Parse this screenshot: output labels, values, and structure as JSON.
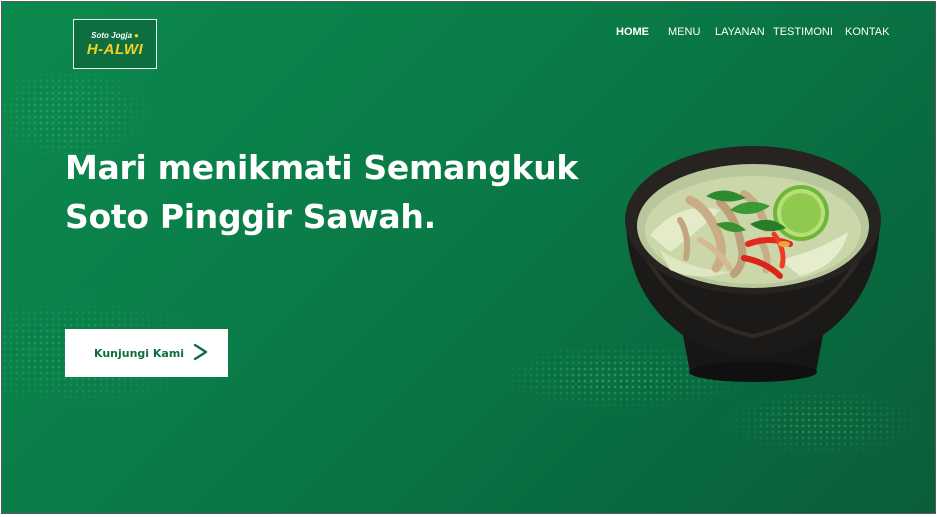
{
  "logo": {
    "top_text": "Soto Jogja",
    "main_text": "H-ALWI"
  },
  "nav": {
    "items": [
      {
        "label": "HOME",
        "active": true
      },
      {
        "label": "MENU",
        "active": false
      },
      {
        "label": "LAYANAN",
        "active": false
      },
      {
        "label": "TESTIMONI",
        "active": false
      },
      {
        "label": "KONTAK",
        "active": false
      }
    ]
  },
  "hero": {
    "title_line1": "Mari menikmati Semangkuk",
    "title_line2": "Soto Pinggir Sawah.",
    "cta_label": "Kunjungi Kami",
    "cta_icon": "chevron-right-icon"
  },
  "colors": {
    "background": "#0a7a47",
    "logo_accent": "#f3d21f",
    "cta_text": "#0d6e40",
    "text": "#ffffff"
  }
}
